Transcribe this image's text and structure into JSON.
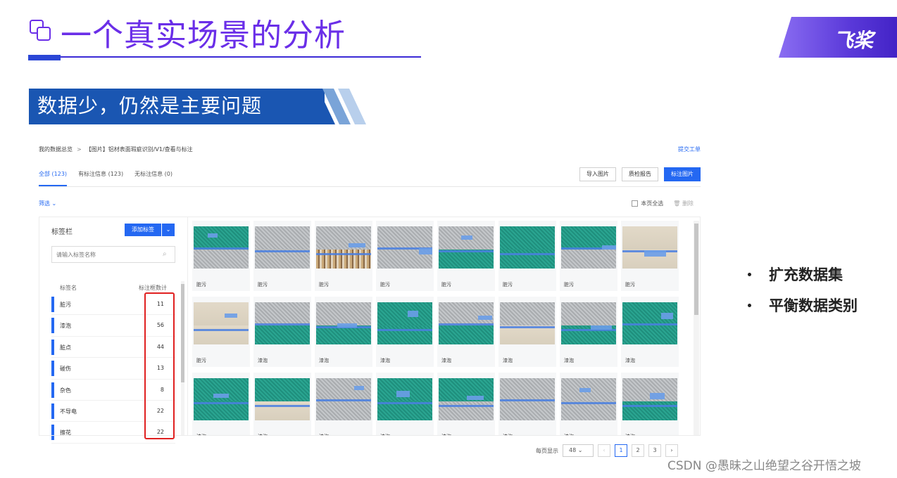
{
  "slide": {
    "title": "一个真实场景的分析",
    "brand_text": "飞桨",
    "section_banner": "数据少，仍然是主要问题",
    "bullets": [
      "扩充数据集",
      "平衡数据类别"
    ],
    "watermark": "CSDN @愚昧之山绝望之谷开悟之坡",
    "colors": {
      "title": "#6a2ee8",
      "banner": "#1a56b2",
      "accent": "#2468f2",
      "highlight": "#e02020"
    }
  },
  "screen": {
    "breadcrumb": [
      "我的数据总览",
      "【图片】铝材表面瑕疵识别/V1/查看与标注"
    ],
    "submit_ticket": "提交工单",
    "tabs": [
      {
        "label": "全部 (123)",
        "active": true
      },
      {
        "label": "有标注信息 (123)",
        "active": false
      },
      {
        "label": "无标注信息 (0)",
        "active": false
      }
    ],
    "actions": {
      "import": "导入图片",
      "quality_report": "质检报告",
      "annotate": "标注图片"
    },
    "filter": "筛选",
    "select_all": "本页全选",
    "delete": "删除",
    "label_panel": {
      "title": "标签栏",
      "add_button": "添加标签",
      "search_placeholder": "请输入标签名称",
      "col_name": "标签名",
      "col_count": "标注框数计",
      "items": [
        {
          "name": "脏污",
          "count": 11
        },
        {
          "name": "漆泡",
          "count": 56
        },
        {
          "name": "脏点",
          "count": 44
        },
        {
          "name": "碰伤",
          "count": 13
        },
        {
          "name": "杂色",
          "count": 8
        },
        {
          "name": "不导电",
          "count": 22
        },
        {
          "name": "擦花",
          "count": 22
        }
      ]
    },
    "thumbnails": [
      {
        "label": "脏污",
        "style": "teal-gray"
      },
      {
        "label": "脏污",
        "style": "gray-gray"
      },
      {
        "label": "脏污",
        "style": "rust"
      },
      {
        "label": "脏污",
        "style": "gray-gray"
      },
      {
        "label": "脏污",
        "style": "gray-teal"
      },
      {
        "label": "脏污",
        "style": "teal-teal"
      },
      {
        "label": "脏污",
        "style": "teal-gray"
      },
      {
        "label": "脏污",
        "style": "beige"
      },
      {
        "label": "脏污",
        "style": "beige-plain"
      },
      {
        "label": "漆泡",
        "style": "gray-teal"
      },
      {
        "label": "漆泡",
        "style": "gray-teal"
      },
      {
        "label": "漆泡",
        "style": "teal-teal"
      },
      {
        "label": "漆泡",
        "style": "gray-teal"
      },
      {
        "label": "漆泡",
        "style": "gray-beige"
      },
      {
        "label": "漆泡",
        "style": "gray-teal"
      },
      {
        "label": "漆泡",
        "style": "teal-teal"
      },
      {
        "label": "漆泡",
        "style": "teal-teal"
      },
      {
        "label": "漆泡",
        "style": "teal-beige"
      },
      {
        "label": "漆泡",
        "style": "gray-gray"
      },
      {
        "label": "漆泡",
        "style": "teal-teal"
      },
      {
        "label": "漆泡",
        "style": "teal-gray"
      },
      {
        "label": "漆泡",
        "style": "gray-gray"
      },
      {
        "label": "漆泡",
        "style": "gray-gray"
      },
      {
        "label": "漆泡",
        "style": "gray-teal"
      }
    ],
    "pagination": {
      "per_page_label": "每页显示",
      "page_size": "48",
      "pages": [
        "1",
        "2",
        "3"
      ],
      "current": "1"
    }
  }
}
